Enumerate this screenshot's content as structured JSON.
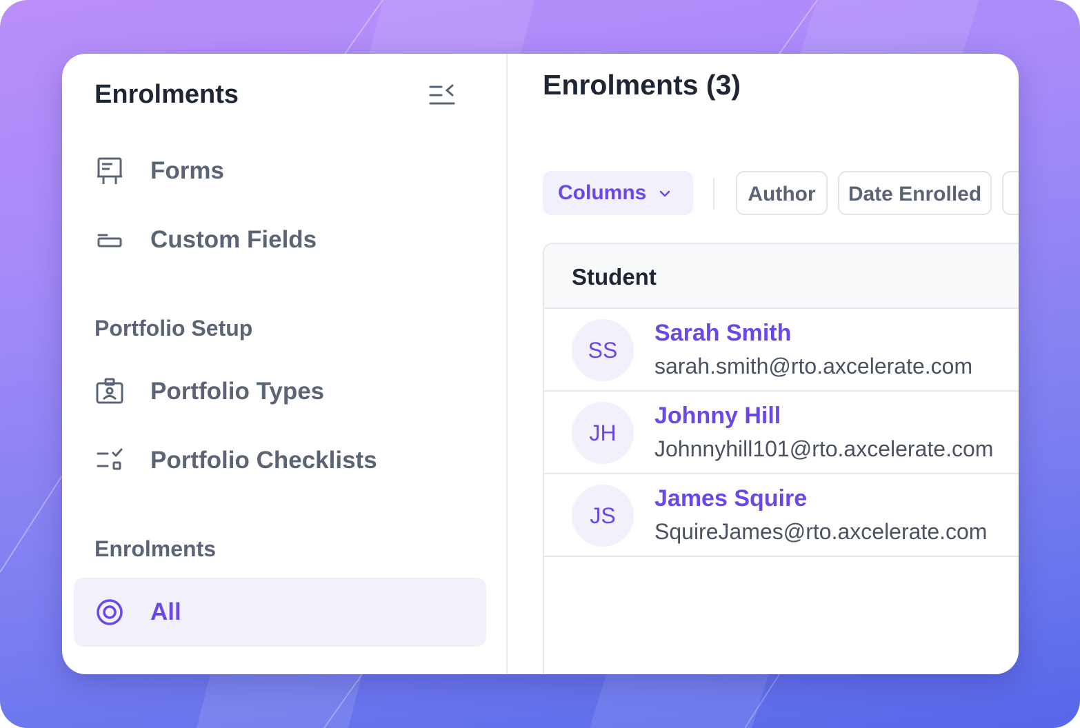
{
  "colors": {
    "accent": "#6a47e8",
    "accent_bg": "#f1f0fb",
    "text_dark": "#1e2533",
    "text_muted": "#5b6474",
    "border": "#e5e7eb"
  },
  "sidebar": {
    "title": "Enrolments",
    "collapse_icon": "collapse-sidebar-icon",
    "items": [
      {
        "label": "Forms",
        "icon": "form-board-icon"
      },
      {
        "label": "Custom Fields",
        "icon": "input-field-icon"
      }
    ],
    "sections": [
      {
        "title": "Portfolio Setup",
        "items": [
          {
            "label": "Portfolio Types",
            "icon": "portfolio-id-icon"
          },
          {
            "label": "Portfolio Checklists",
            "icon": "checklist-icon"
          }
        ]
      },
      {
        "title": "Enrolments",
        "items": [
          {
            "label": "All",
            "icon": "target-circle-icon",
            "active": true
          }
        ]
      }
    ]
  },
  "main": {
    "title": "Enrolments (3)",
    "toolbar": {
      "columns_label": "Columns",
      "filters": [
        "Author",
        "Date Enrolled"
      ]
    },
    "table": {
      "columns": [
        "Student"
      ],
      "rows": [
        {
          "initials": "SS",
          "name": "Sarah Smith",
          "email": "sarah.smith@rto.axcelerate.com"
        },
        {
          "initials": "JH",
          "name": "Johnny Hill",
          "email": "Johnnyhill101@rto.axcelerate.com"
        },
        {
          "initials": "JS",
          "name": "James Squire",
          "email": "SquireJames@rto.axcelerate.com"
        }
      ]
    }
  }
}
